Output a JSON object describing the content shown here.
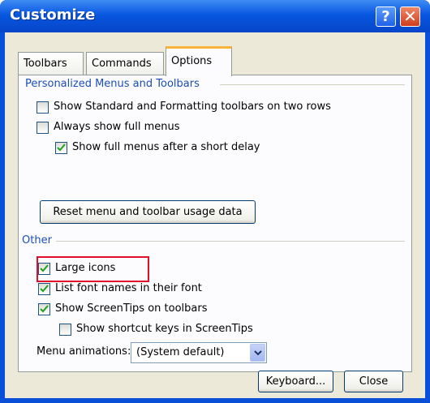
{
  "window": {
    "title": "Customize"
  },
  "title_buttons": {
    "help": "?",
    "close": "✕"
  },
  "tabs": [
    {
      "label": "Toolbars"
    },
    {
      "label": "Commands"
    },
    {
      "label": "Options",
      "active": true
    }
  ],
  "personalized": {
    "heading": "Personalized Menus and Toolbars",
    "options": [
      {
        "label": "Show Standard and Formatting toolbars on two rows",
        "checked": false
      },
      {
        "label": "Always show full menus",
        "checked": false
      },
      {
        "label": "Show full menus after a short delay",
        "checked": true
      }
    ],
    "reset_button": "Reset menu and toolbar usage data"
  },
  "other": {
    "heading": "Other",
    "options": [
      {
        "label": "Large icons",
        "checked": true
      },
      {
        "label": "List font names in their font",
        "checked": true
      },
      {
        "label": "Show ScreenTips on toolbars",
        "checked": true
      },
      {
        "label": "Show shortcut keys in ScreenTips",
        "checked": false
      }
    ],
    "menu_animations_label": "Menu animations:",
    "menu_animations_value": "(System default)"
  },
  "footer": {
    "keyboard_button": "Keyboard...",
    "close_button": "Close"
  },
  "colors": {
    "title_bar": "#0857e0",
    "highlight_box": "#e0102a",
    "section_heading": "#1a4fb8",
    "checkmark": "#21a121"
  }
}
